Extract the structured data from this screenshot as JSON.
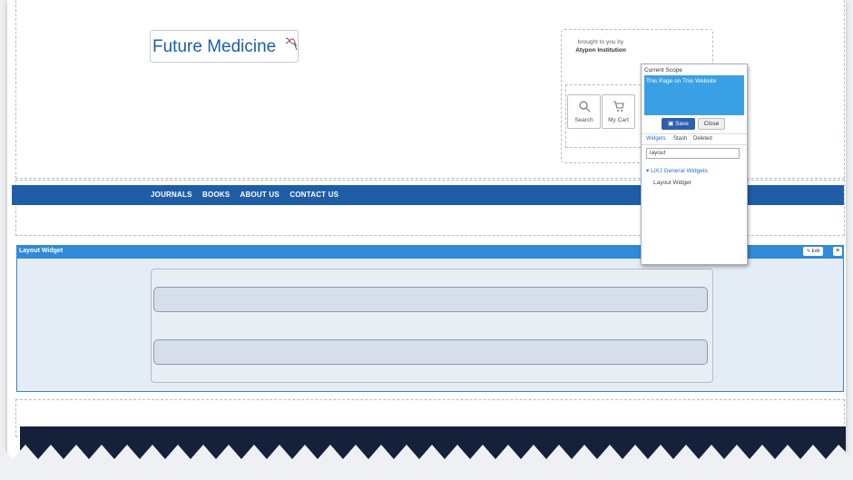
{
  "header": {
    "logo_text": "Future Medicine",
    "brought_line1": "brought to you by",
    "brought_line2": "Atypon Institution",
    "search_label": "Search",
    "cart_label": "My Cart"
  },
  "nav": {
    "items": [
      {
        "label": "JOURNALS"
      },
      {
        "label": "BOOKS"
      },
      {
        "label": "ABOUT US"
      },
      {
        "label": "CONTACT US"
      }
    ]
  },
  "layout_widget": {
    "title": "Layout Widget",
    "edit_label": "Edit",
    "menu_glyph": "≡"
  },
  "panel": {
    "scope_label": "Current Scope",
    "scope_value": "This Page on This Website",
    "save_label": "Save",
    "close_label": "Close",
    "tabs": [
      "Widgets",
      "Stash",
      "Deleted"
    ],
    "search_value": "layout",
    "group_label": "▾ LiXJ General Widgets",
    "item_label": "Layout Widget"
  },
  "colors": {
    "brand_blue": "#1f5ea6",
    "widget_bar": "#3189d8",
    "scope_highlight": "#3aa0e6",
    "footer": "#15203a"
  }
}
